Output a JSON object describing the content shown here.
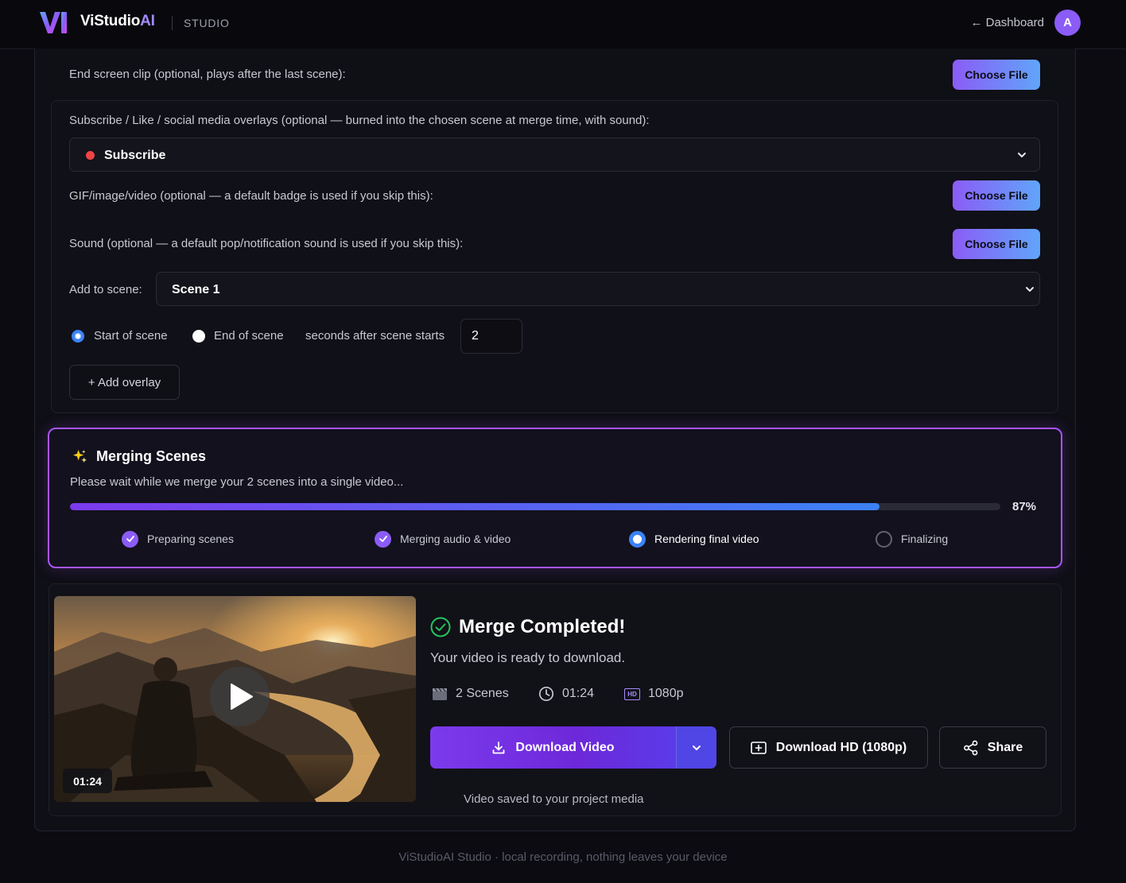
{
  "header": {
    "brand_name": "ViStudio",
    "brand_ai": "AI",
    "section": "STUDIO",
    "dashboard_link": "← Dashboard",
    "avatar_initial": "A"
  },
  "end_screen": {
    "label": "End screen clip (optional, plays after the last scene):",
    "button": "Choose File"
  },
  "overlays": {
    "label": "Subscribe / Like / social media overlays (optional — burned into the chosen scene at merge time, with sound):",
    "type_selected": "Subscribe",
    "media_label": "GIF/image/video (optional — a default badge is used if you skip this):",
    "media_button": "Choose File",
    "sound_label": "Sound (optional — a default pop/notification sound is used if you skip this):",
    "sound_button": "Choose File",
    "scene_label": "Add to scene:",
    "scene_selected": "Scene 1",
    "start_option": "Start of scene",
    "end_option": "End of scene",
    "seconds_label": "seconds after scene starts",
    "seconds_value": "2",
    "add_button": "+ Add overlay"
  },
  "merging": {
    "icon": "sparkles-icon",
    "title": "Merging Scenes",
    "description": "Please wait while we merge your 2 scenes into a single video...",
    "progress_percent": 87,
    "progress_label": "87%",
    "steps": [
      {
        "label": "Preparing scenes",
        "state": "done"
      },
      {
        "label": "Merging audio & video",
        "state": "done"
      },
      {
        "label": "Rendering final video",
        "state": "active"
      },
      {
        "label": "Finalizing",
        "state": "pending"
      }
    ]
  },
  "result": {
    "thumbnail_duration": "01:24",
    "title": "Merge Completed!",
    "subtitle": "Your video is ready to download.",
    "scenes": "2 Scenes",
    "duration": "01:24",
    "hd_badge": "HD",
    "resolution": "1080p",
    "download_button": "Download Video",
    "download_hd_button": "Download HD (1080p)",
    "share_button": "Share",
    "saved_note": "Video saved to your project media"
  },
  "footer": {
    "text": "ViStudioAI Studio · local recording, nothing leaves your device"
  },
  "colors": {
    "accent_purple": "#8b5cf6",
    "accent_blue": "#3b82f6",
    "success_green": "#22c55e",
    "record_red": "#ef4444"
  }
}
